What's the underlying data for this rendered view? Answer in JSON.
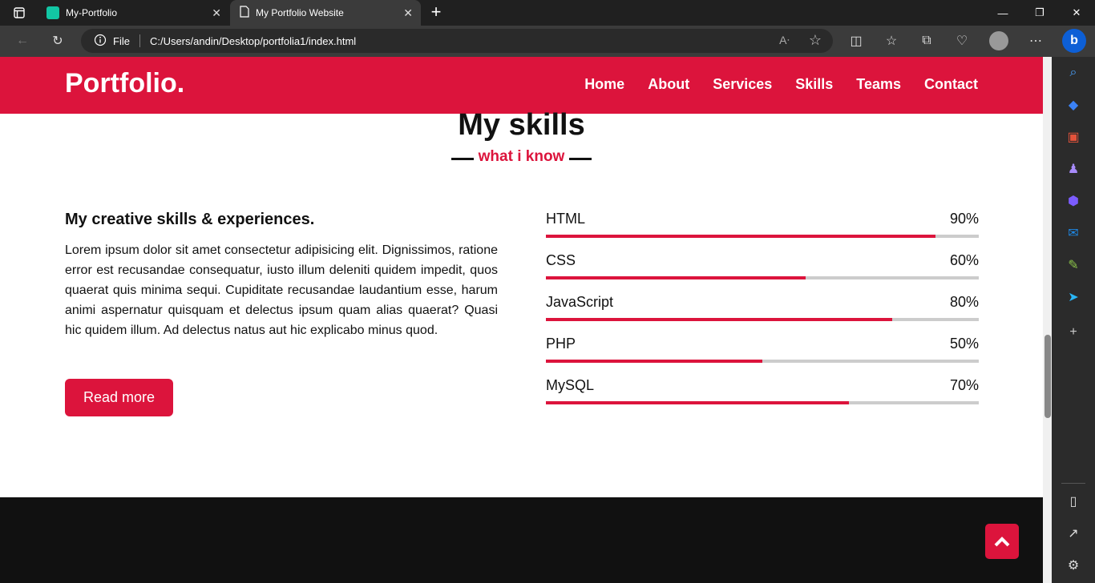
{
  "browser": {
    "tabs": [
      {
        "title": "My-Portfolio",
        "favicon_color": "#12c6a4",
        "active": false
      },
      {
        "title": "My Portfolio Website",
        "active": true
      }
    ],
    "address": {
      "scheme_label": "File",
      "url": "C:/Users/andin/Desktop/portfolia1/index.html"
    },
    "colors": {
      "chrome": "#202020",
      "toolbar": "#3b3b3b"
    }
  },
  "page": {
    "logo": "Portfolio.",
    "nav": [
      "Home",
      "About",
      "Services",
      "Skills",
      "Teams",
      "Contact"
    ],
    "section_title": "My skills",
    "section_subtitle": "what i know",
    "heading": "My creative skills & experiences.",
    "paragraph": "Lorem ipsum dolor sit amet consectetur adipisicing elit. Dignissimos, ratione error est recusandae consequatur, iusto illum deleniti quidem impedit, quos quaerat quis minima sequi. Cupiditate recusandae laudantium esse, harum animi aspernatur quisquam et delectus ipsum quam alias quaerat? Quasi hic quidem illum. Ad delectus natus aut hic explicabo minus quod.",
    "button": "Read more",
    "skills": [
      {
        "name": "HTML",
        "percent": "90%",
        "value": 90
      },
      {
        "name": "CSS",
        "percent": "60%",
        "value": 60
      },
      {
        "name": "JavaScript",
        "percent": "80%",
        "value": 80
      },
      {
        "name": "PHP",
        "percent": "50%",
        "value": 50
      },
      {
        "name": "MySQL",
        "percent": "70%",
        "value": 70
      }
    ],
    "colors": {
      "accent": "#dc143c",
      "footer": "#111111"
    }
  }
}
